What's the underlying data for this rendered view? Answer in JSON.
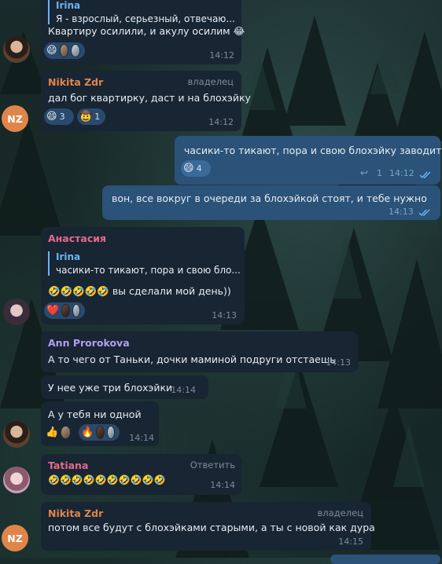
{
  "messages": {
    "m1": {
      "reply_name": "Irina",
      "reply_text": "Я - взрослый, серьезный, отвечаю...",
      "text": "Квартиру осилили, и акулу осилим 😂",
      "time": "14:12",
      "reaction_emoji": "😄"
    },
    "m2": {
      "sender": "Nikita Zdr",
      "role": "владелец",
      "text": "дал бог квартирку, даст и на блохэйку",
      "time": "14:12",
      "reactions": [
        {
          "emoji": "😄",
          "count": "3"
        },
        {
          "emoji": "🤠",
          "count": "1"
        }
      ]
    },
    "m3": {
      "text": "часики-то тикают, пора и свою блохэйку заводить",
      "reaction_emoji": "😄",
      "reaction_count": "4",
      "reply_count": "1",
      "time": "14:12"
    },
    "m4": {
      "text": "вон, все вокруг в очереди за блохэйкой стоят, и тебе нужно",
      "time": "14:13"
    },
    "m5": {
      "sender": "Анастасия",
      "reply_name": "Irina",
      "reply_text": "часики-то тикают, пора и свою бло...",
      "emojis": "🤣🤣🤣🤣🤣",
      "text": "вы сделали мой день))",
      "time": "14:13",
      "reaction_emoji": "❤️"
    },
    "m6": {
      "sender": "Ann Prorokova",
      "text": "А то чего от Таньки, дочки маминой подруги отстаешь",
      "time": "14:13"
    },
    "m7": {
      "text": "У нее уже три блохэйки",
      "time": "14:14"
    },
    "m8": {
      "text": "А у тебя ни одной",
      "time": "14:14",
      "reaction1": "👍",
      "reaction2": "🔥"
    },
    "m9": {
      "sender": "Tatiana",
      "reply_action": "Ответить",
      "emojis": "🤣🤣🤣🤣🤣🤣🤣🤣🤣🤣",
      "time": "14:14"
    },
    "m10": {
      "sender": "Nikita Zdr",
      "role": "владелец",
      "text": "потом все будут с блохэйками старыми, а ты с новой как дура",
      "time": "14:15"
    }
  },
  "avatars": {
    "nz_initials": "NZ"
  },
  "colors": {
    "incoming_bubble": "#182533",
    "outgoing_bubble": "#2b5278",
    "link_blue": "#6ab3f3",
    "nikita_name": "#e0854a",
    "anastasia_name": "#e56a8a",
    "ann_name": "#b59cf0",
    "tatiana_name": "#e56a8a"
  }
}
